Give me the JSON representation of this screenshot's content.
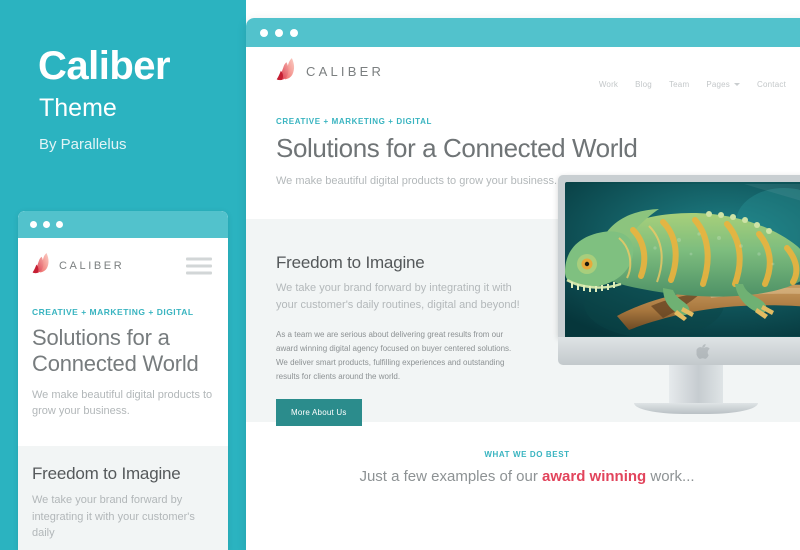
{
  "promo": {
    "title": "Caliber",
    "subtitle": "Theme",
    "author": "By Parallelus",
    "bg_color": "#2bb3c0"
  },
  "brand": {
    "name": "CALIBER",
    "logo_icon": "flame-logo-icon",
    "accent_color": "#e2445c"
  },
  "mobile_mockup": {
    "window_dots": 3,
    "menu_icon": "hamburger-menu-icon",
    "hero": {
      "eyebrow": "CREATIVE + MARKETING + DIGITAL",
      "heading": "Solutions for a Connected World",
      "lead": "We make beautiful digital products to grow your business."
    },
    "feature": {
      "heading": "Freedom to Imagine",
      "body": "We take your brand forward by integrating it with your customer's daily"
    }
  },
  "desktop_mockup": {
    "window_dots": 3,
    "nav": [
      {
        "label": "Work",
        "has_dropdown": false
      },
      {
        "label": "Blog",
        "has_dropdown": false
      },
      {
        "label": "Team",
        "has_dropdown": false
      },
      {
        "label": "Pages",
        "has_dropdown": true
      },
      {
        "label": "Contact",
        "has_dropdown": false
      }
    ],
    "hero": {
      "eyebrow": "CREATIVE + MARKETING + DIGITAL",
      "heading": "Solutions for a Connected World",
      "lead": "We make beautiful digital products to grow your business."
    },
    "feature": {
      "heading": "Freedom to Imagine",
      "subheading": "We take your brand forward by integrating it with your customer's daily routines, digital and beyond!",
      "paragraph": "As a team we are serious about delivering great results from our award winning digital agency focused on buyer centered solutions. We deliver smart products, fulfilling experiences and outstanding results for clients around the world.",
      "button_label": "More About Us",
      "button_color": "#2b8c8c",
      "image_alt": "chameleon-on-branch-photo",
      "device_icon": "imac-monitor-icon"
    },
    "bottom": {
      "eyebrow": "WHAT WE DO BEST",
      "text_before": "Just a few examples of our ",
      "highlight": "award winning",
      "text_after": " work..."
    }
  }
}
